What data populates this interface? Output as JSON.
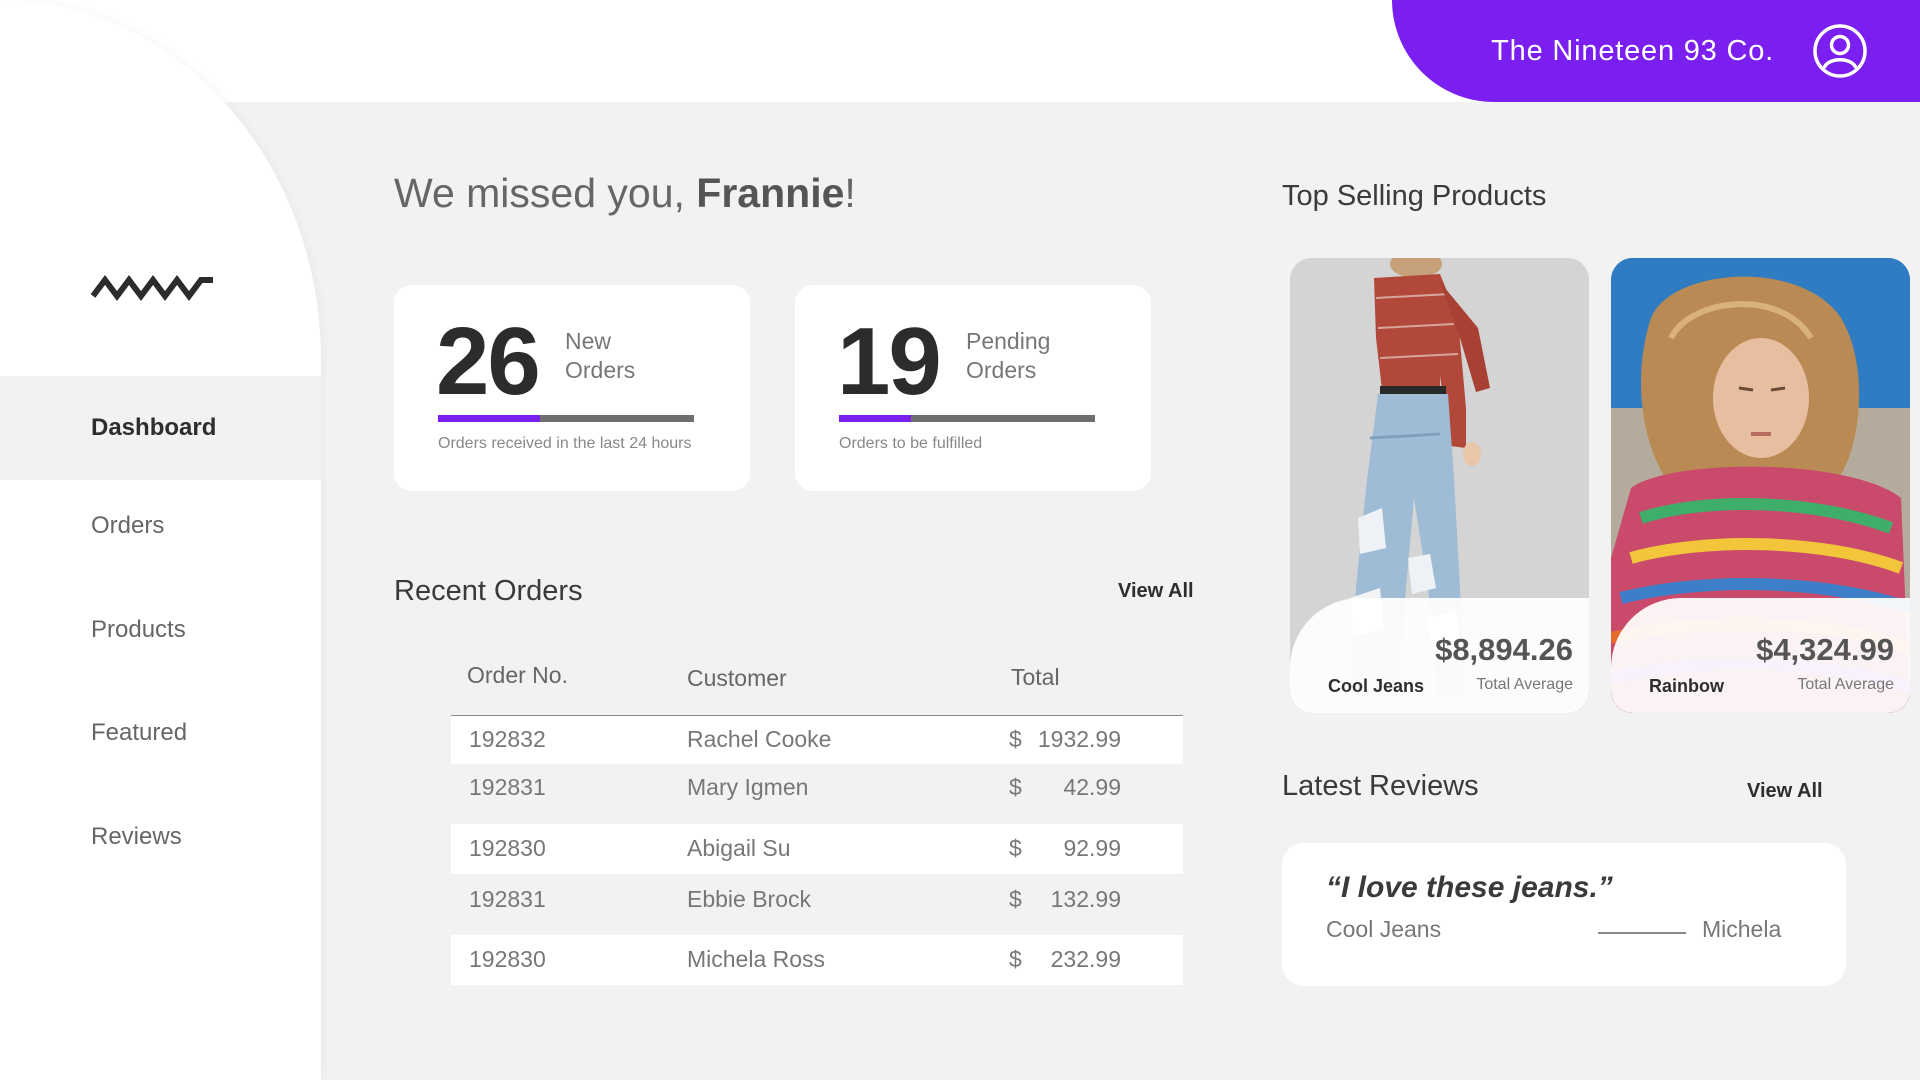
{
  "brand": {
    "name": "The Nineteen 93 Co.",
    "accent": "#7a1ff0"
  },
  "sidebar": {
    "items": [
      {
        "label": "Dashboard",
        "active": true
      },
      {
        "label": "Orders",
        "active": false
      },
      {
        "label": "Products",
        "active": false
      },
      {
        "label": "Featured",
        "active": false
      },
      {
        "label": "Reviews",
        "active": false
      }
    ]
  },
  "greeting": {
    "prefix": "We missed you, ",
    "name": "Frannie",
    "suffix": "!"
  },
  "stats": [
    {
      "value": "26",
      "label": "New Orders",
      "caption": "Orders received in the last 24 hours",
      "progress": 0.4
    },
    {
      "value": "19",
      "label": "Pending Orders",
      "caption": "Orders to be fulfilled",
      "progress": 0.28
    }
  ],
  "recent_orders": {
    "title": "Recent Orders",
    "view_all": "View All",
    "columns": [
      "Order No.",
      "Customer",
      "Total"
    ],
    "rows": [
      {
        "order": "192832",
        "customer": "Rachel Cooke",
        "currency": "$",
        "amount": "1932.99"
      },
      {
        "order": "192831",
        "customer": "Mary Igmen",
        "currency": "$",
        "amount": "42.99"
      },
      {
        "order": "192830",
        "customer": "Abigail Su",
        "currency": "$",
        "amount": "92.99"
      },
      {
        "order": "192831",
        "customer": "Ebbie Brock",
        "currency": "$",
        "amount": "132.99"
      },
      {
        "order": "192830",
        "customer": "Michela Ross",
        "currency": "$",
        "amount": "232.99"
      }
    ]
  },
  "top_selling": {
    "title": "Top Selling Products",
    "products": [
      {
        "name": "Cool Jeans",
        "price": "$8,894.26",
        "sub": "Total Average"
      },
      {
        "name": "Rainbow",
        "price": "$4,324.99",
        "sub": "Total Average"
      }
    ]
  },
  "latest_reviews": {
    "title": "Latest Reviews",
    "view_all": "View All",
    "review": {
      "quote": "“I love these jeans.”",
      "product": "Cool Jeans",
      "author": "Michela"
    }
  }
}
